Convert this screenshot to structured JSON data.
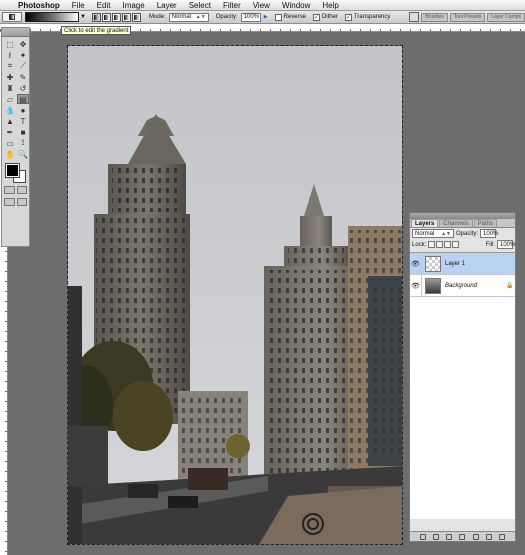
{
  "menubar": {
    "app": "Photoshop",
    "items": [
      "File",
      "Edit",
      "Image",
      "Layer",
      "Select",
      "Filter",
      "View",
      "Window",
      "Help"
    ]
  },
  "options": {
    "mode_label": "Mode:",
    "mode_value": "Normal",
    "opacity_label": "Opacity:",
    "opacity_value": "100%",
    "reverse_label": "Reverse",
    "dither_label": "Dither",
    "transparency_label": "Transparency",
    "reverse_checked": false,
    "dither_checked": true,
    "transparency_checked": true,
    "well_tabs": [
      "Brushes",
      "Tool Presets",
      "Layer Comps"
    ]
  },
  "tooltip": "Click to edit the gradient",
  "layers_panel": {
    "tabs": [
      "Layers",
      "Channels",
      "Paths"
    ],
    "blend_mode": "Normal",
    "opacity_label": "Opacity:",
    "opacity_value": "100%",
    "lock_label": "Lock:",
    "fill_label": "Fill:",
    "fill_value": "100%",
    "layers": [
      {
        "name": "Layer 1",
        "selected": true,
        "thumb": "transparent"
      },
      {
        "name": "Background",
        "selected": false,
        "thumb": "photo",
        "locked": true
      }
    ]
  },
  "colors": {
    "foreground": "#000000",
    "background": "#ffffff",
    "selection_highlight": "#b9d1f2"
  }
}
